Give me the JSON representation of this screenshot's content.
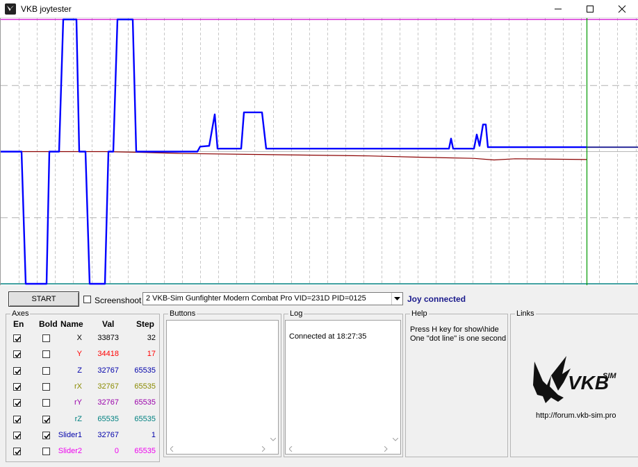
{
  "window": {
    "title": "VKB joytester",
    "icons": {
      "app": "vkb-app-icon",
      "minimize": "minimize-icon",
      "maximize": "maximize-icon",
      "close": "close-icon"
    }
  },
  "graph": {
    "x_dotted_gridline_count": 34,
    "colors": {
      "x_axis": "#0000ff",
      "y_axis": "#8b0000",
      "upper_limit": "#cc00cc",
      "lower_limit": "#008080",
      "cursor": "#009900"
    },
    "chart_data": {
      "type": "line",
      "ylim": [
        0,
        65535
      ],
      "grid": true,
      "series": [
        {
          "name": "X",
          "color": "#0000ff",
          "points": [
            [
              0,
              32767
            ],
            [
              30,
              32767
            ],
            [
              36,
              0
            ],
            [
              66,
              0
            ],
            [
              70,
              32767
            ],
            [
              84,
              32767
            ],
            [
              90,
              65535
            ],
            [
              109,
              65535
            ],
            [
              113,
              32767
            ],
            [
              122,
              32767
            ],
            [
              128,
              0
            ],
            [
              150,
              0
            ],
            [
              155,
              32767
            ],
            [
              162,
              32767
            ],
            [
              168,
              65535
            ],
            [
              190,
              65535
            ],
            [
              195,
              32767
            ],
            [
              283,
              32767
            ],
            [
              287,
              34000
            ],
            [
              300,
              34200
            ],
            [
              308,
              42000
            ],
            [
              312,
              33500
            ],
            [
              346,
              33500
            ],
            [
              350,
              42500
            ],
            [
              376,
              42500
            ],
            [
              382,
              33500
            ],
            [
              645,
              33500
            ],
            [
              648,
              36000
            ],
            [
              651,
              33500
            ],
            [
              681,
              33500
            ],
            [
              685,
              37000
            ],
            [
              689,
              34200
            ],
            [
              694,
              39500
            ],
            [
              698,
              39500
            ],
            [
              701,
              33873
            ],
            [
              843,
              33873
            ]
          ]
        },
        {
          "name": "Y",
          "color": "#8b0000",
          "points": [
            [
              0,
              32767
            ],
            [
              150,
              32767
            ],
            [
              200,
              32600
            ],
            [
              260,
              32300
            ],
            [
              400,
              32000
            ],
            [
              530,
              31700
            ],
            [
              600,
              31400
            ],
            [
              680,
              31100
            ],
            [
              710,
              30700
            ],
            [
              740,
              31000
            ],
            [
              843,
              30800
            ]
          ]
        },
        {
          "name": "rZ",
          "color": "#008080",
          "points": [
            [
              0,
              65535
            ],
            [
              843,
              65535
            ]
          ]
        }
      ]
    }
  },
  "controls": {
    "start_label": "START",
    "screenshot_label": "Screenshoot",
    "screenshot_checked": false,
    "device_value": "2  VKB-Sim Gunfighter Modern Combat Pro  VID=231D PID=0125",
    "status_text": "Joy connected",
    "status_color": "#1a1a8c"
  },
  "axes": {
    "group_title": "Axes",
    "headers": {
      "en": "En",
      "bold": "Bold",
      "name": "Name",
      "val": "Val",
      "step": "Step"
    },
    "rows": [
      {
        "name": "X",
        "val": "33873",
        "step": "32",
        "color": "#000000",
        "en": true,
        "bold": false
      },
      {
        "name": "Y",
        "val": "34418",
        "step": "17",
        "color": "#ff0000",
        "en": true,
        "bold": false
      },
      {
        "name": "Z",
        "val": "32767",
        "step": "65535",
        "color": "#0000aa",
        "en": true,
        "bold": false
      },
      {
        "name": "rX",
        "val": "32767",
        "step": "65535",
        "color": "#8a8a00",
        "en": true,
        "bold": false
      },
      {
        "name": "rY",
        "val": "32767",
        "step": "65535",
        "color": "#9900aa",
        "en": true,
        "bold": false
      },
      {
        "name": "rZ",
        "val": "65535",
        "step": "65535",
        "color": "#008080",
        "en": true,
        "bold": true
      },
      {
        "name": "Slider1",
        "val": "32767",
        "step": "1",
        "color": "#0000aa",
        "en": true,
        "bold": true
      },
      {
        "name": "Slider2",
        "val": "0",
        "step": "65535",
        "color": "#ee00ee",
        "en": true,
        "bold": false
      }
    ]
  },
  "buttons_panel": {
    "title": "Buttons"
  },
  "log_panel": {
    "title": "Log",
    "entries": [
      "Connected at 18:27:35"
    ]
  },
  "help_panel": {
    "title": "Help",
    "lines": [
      "Press H key for show\\hide",
      "One \"dot line\" is one second"
    ]
  },
  "links_panel": {
    "title": "Links",
    "logo_text": "VKB",
    "logo_sub": "SIM",
    "url": "http://forum.vkb-sim.pro"
  }
}
